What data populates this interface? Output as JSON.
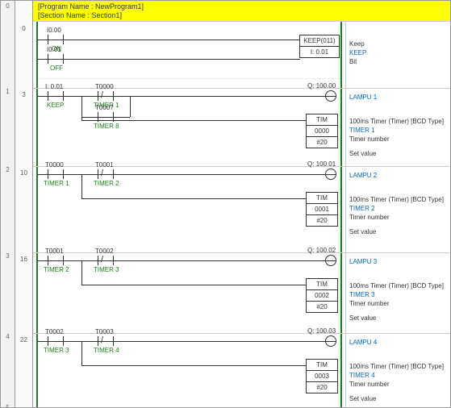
{
  "header": {
    "program": "[Program Name : NewProgram1]",
    "section": "[Section Name : Section1]"
  },
  "gutter": [
    "0",
    "1",
    "2",
    "3",
    "4",
    "5"
  ],
  "lines": {
    "r0": "0",
    "r1": "3",
    "r2": "10",
    "r3": "16",
    "r4": "22"
  },
  "rung0": {
    "in1_addr": "I0.00",
    "in1_name": "ON",
    "in2_addr": "I0.01",
    "in2_name": "OFF",
    "box_title": "KEEP(011)",
    "box_op": "I: 0.01",
    "cmt_title": "Keep",
    "cmt_name": "KEEP",
    "cmt_sub": "Bit"
  },
  "rung1": {
    "c1_addr": "I: 0.01",
    "c1_name": "KEEP",
    "c2_addr": "T0000",
    "c2_name": "TIMER 1",
    "c3_addr": "T0007",
    "c3_name": "TIMER 8",
    "out_addr": "Q: 100.00",
    "out_name": "LAMPU 1",
    "box_title": "TIM",
    "box_op1": "0000",
    "box_op2": "#20",
    "cmt_title": "100ms Timer (Timer) [BCD Type]",
    "cmt_name": "TIMER 1",
    "cmt_l1": "Timer number",
    "cmt_l2": "Set value"
  },
  "rung2": {
    "c1_addr": "T0000",
    "c1_name": "TIMER 1",
    "c2_addr": "T0001",
    "c2_name": "TIMER 2",
    "out_addr": "Q: 100.01",
    "out_name": "LAMPU 2",
    "box_title": "TIM",
    "box_op1": "0001",
    "box_op2": "#20",
    "cmt_title": "100ms Timer (Timer) [BCD Type]",
    "cmt_name": "TIMER 2",
    "cmt_l1": "Timer number",
    "cmt_l2": "Set value"
  },
  "rung3": {
    "c1_addr": "T0001",
    "c1_name": "TIMER 2",
    "c2_addr": "T0002",
    "c2_name": "TIMER 3",
    "out_addr": "Q: 100.02",
    "out_name": "LAMPU 3",
    "box_title": "TIM",
    "box_op1": "0002",
    "box_op2": "#20",
    "cmt_title": "100ms Timer (Timer) [BCD Type]",
    "cmt_name": "TIMER 3",
    "cmt_l1": "Timer number",
    "cmt_l2": "Set value"
  },
  "rung4": {
    "c1_addr": "T0002",
    "c1_name": "TIMER 3",
    "c2_addr": "T0003",
    "c2_name": "TIMER 4",
    "out_addr": "Q: 100.03",
    "out_name": "LAMPU 4",
    "box_title": "TIM",
    "box_op1": "0003",
    "box_op2": "#20",
    "cmt_title": "100ms Timer (Timer) [BCD Type]",
    "cmt_name": "TIMER 4",
    "cmt_l1": "Timer number",
    "cmt_l2": "Set value"
  },
  "chart_data": {
    "type": "ladder-diagram",
    "rungs": [
      {
        "branches": [
          [
            {
              "type": "NO",
              "addr": "I0.00",
              "name": "ON"
            }
          ],
          [
            {
              "type": "NO",
              "addr": "I0.01",
              "name": "OFF"
            }
          ]
        ],
        "output": {
          "instr": "KEEP(011)",
          "operands": [
            "I:0.01"
          ],
          "comment": "Keep / KEEP / Bit"
        }
      },
      {
        "branches": [
          [
            {
              "type": "NO",
              "addr": "I:0.01",
              "name": "KEEP"
            },
            {
              "type": "NC",
              "addr": "T0000",
              "name": "TIMER 1"
            }
          ],
          [
            {
              "type": "NO",
              "addr": "T0007",
              "name": "TIMER 8"
            }
          ]
        ],
        "outputs": [
          {
            "type": "coil",
            "addr": "Q:100.00",
            "name": "LAMPU 1"
          },
          {
            "instr": "TIM",
            "operands": [
              "0000",
              "#20"
            ],
            "comment": "100ms Timer (Timer) [BCD Type] / TIMER 1 / Timer number / Set value"
          }
        ]
      },
      {
        "contacts": [
          {
            "type": "NO",
            "addr": "T0000",
            "name": "TIMER 1"
          },
          {
            "type": "NC",
            "addr": "T0001",
            "name": "TIMER 2"
          }
        ],
        "outputs": [
          {
            "type": "coil",
            "addr": "Q:100.01",
            "name": "LAMPU 2"
          },
          {
            "instr": "TIM",
            "operands": [
              "0001",
              "#20"
            ],
            "comment": "100ms Timer (Timer) [BCD Type] / TIMER 2 / Timer number / Set value"
          }
        ]
      },
      {
        "contacts": [
          {
            "type": "NO",
            "addr": "T0001",
            "name": "TIMER 2"
          },
          {
            "type": "NC",
            "addr": "T0002",
            "name": "TIMER 3"
          }
        ],
        "outputs": [
          {
            "type": "coil",
            "addr": "Q:100.02",
            "name": "LAMPU 3"
          },
          {
            "instr": "TIM",
            "operands": [
              "0002",
              "#20"
            ],
            "comment": "100ms Timer (Timer) [BCD Type] / TIMER 3 / Timer number / Set value"
          }
        ]
      },
      {
        "contacts": [
          {
            "type": "NO",
            "addr": "T0002",
            "name": "TIMER 3"
          },
          {
            "type": "NC",
            "addr": "T0003",
            "name": "TIMER 4"
          }
        ],
        "outputs": [
          {
            "type": "coil",
            "addr": "Q:100.03",
            "name": "LAMPU 4"
          },
          {
            "instr": "TIM",
            "operands": [
              "0003",
              "#20"
            ],
            "comment": "100ms Timer (Timer) [BCD Type] / TIMER 4 / Timer number / Set value"
          }
        ]
      }
    ]
  }
}
